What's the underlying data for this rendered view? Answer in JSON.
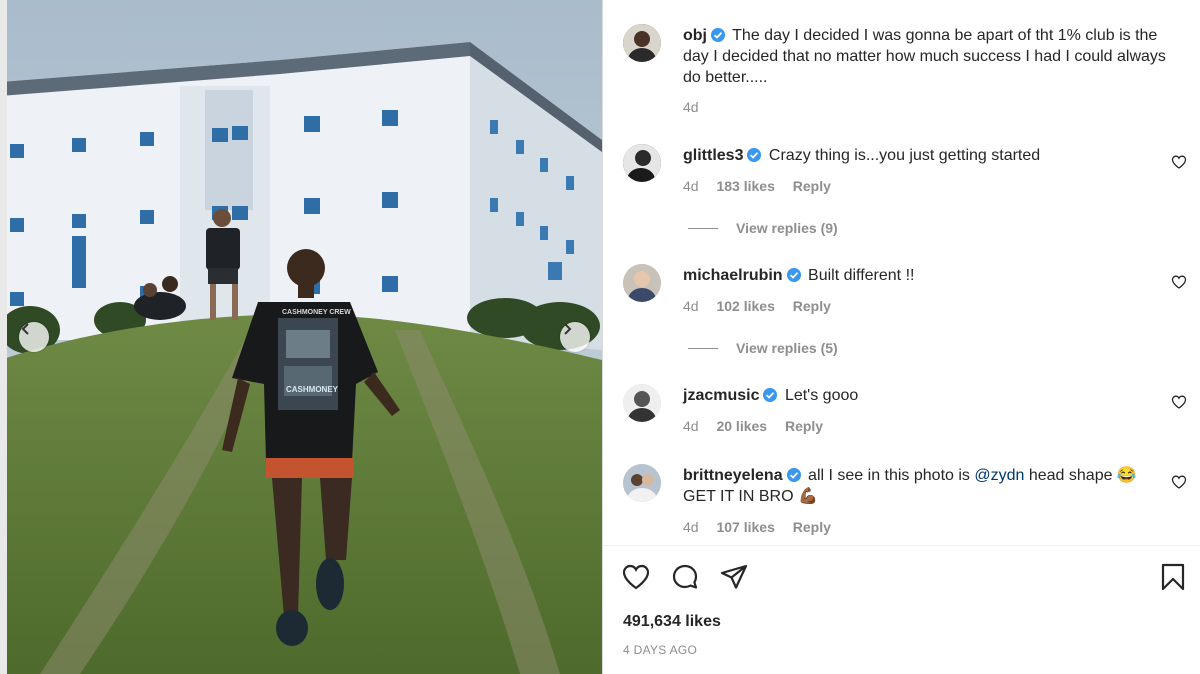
{
  "post": {
    "author": "obj",
    "caption": "The day I decided I was gonna be apart of tht 1% club is the day I decided that no matter how much success I had I could always do better.....",
    "time": "4d"
  },
  "comments": [
    {
      "username": "glittles3",
      "text": "Crazy thing is...you just getting started",
      "time": "4d",
      "likes": "183 likes",
      "reply": "Reply",
      "view_replies": "View replies (9)"
    },
    {
      "username": "michaelrubin",
      "text": "Built different !!",
      "time": "4d",
      "likes": "102 likes",
      "reply": "Reply",
      "view_replies": "View replies (5)"
    },
    {
      "username": "jzacmusic",
      "text": "Let's gooo",
      "time": "4d",
      "likes": "20 likes",
      "reply": "Reply"
    },
    {
      "username": "brittneyelena",
      "text_before": "all I see in this photo is ",
      "mention": "@zydn",
      "text_after": " head shape 😂 GET IT IN BRO 💪🏾",
      "time": "4d",
      "likes": "107 likes",
      "reply": "Reply"
    }
  ],
  "footer": {
    "likes": "491,634 likes",
    "time_ago": "4 DAYS AGO"
  },
  "photo": {
    "shirt_text_top": "CASHMONEY CREW",
    "shirt_text_bottom": "CASHMONEY"
  },
  "icons": {
    "like": "heart-icon",
    "comment": "comment-bubble-icon",
    "share": "paper-plane-icon",
    "save": "bookmark-icon",
    "verified": "verified-badge-icon",
    "prev": "chevron-left-icon",
    "next": "chevron-right-icon"
  },
  "colors": {
    "verified": "#3897f0",
    "muted": "#8e8e8e",
    "text": "#262626",
    "mention": "#00376b"
  }
}
